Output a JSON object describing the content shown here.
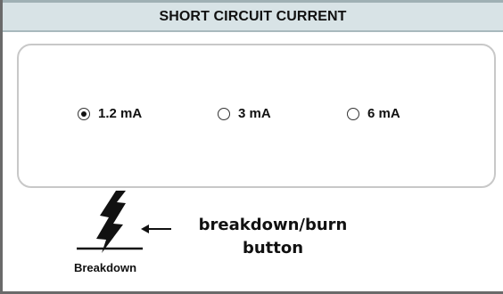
{
  "header": {
    "title": "SHORT CIRCUIT CURRENT"
  },
  "current_options": [
    {
      "label": "1.2 mA",
      "selected": true
    },
    {
      "label": "3 mA",
      "selected": false
    },
    {
      "label": "6 mA",
      "selected": false
    }
  ],
  "breakdown_button": {
    "label": "Breakdown",
    "icon": "lightning-bolt-icon"
  },
  "annotation": {
    "line1": "breakdown/burn",
    "line2": "button"
  },
  "colors": {
    "header_bg": "#d8e3e6",
    "panel_border": "#c8c8c8"
  }
}
